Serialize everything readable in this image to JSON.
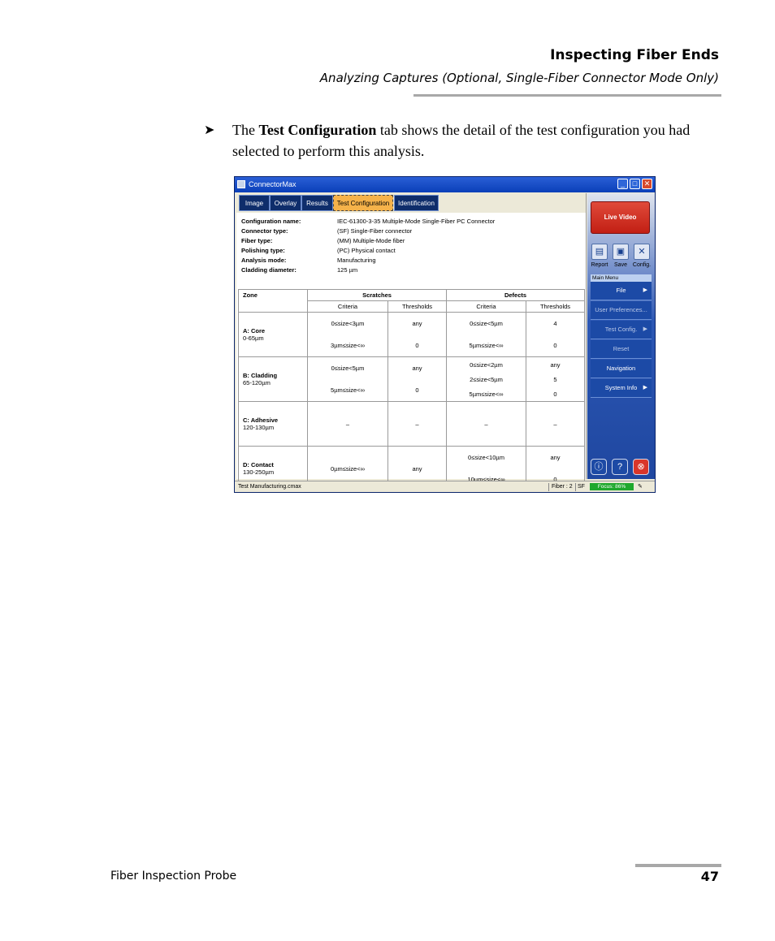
{
  "header": {
    "title": "Inspecting Fiber Ends",
    "subtitle": "Analyzing Captures (Optional, Single-Fiber Connector Mode Only)"
  },
  "body": {
    "bullet": "➤",
    "text_pre": "The ",
    "text_bold": "Test Configuration",
    "text_post": " tab shows the detail of the test configuration you had selected to perform this analysis."
  },
  "app": {
    "title": "ConnectorMax",
    "window_buttons": [
      "_",
      "□",
      "✕"
    ],
    "tabs": [
      "Image",
      "Overlay",
      "Results",
      "Test Configuration",
      "Identification"
    ],
    "info": [
      {
        "label": "Configuration name:",
        "value": "IEC-61300-3-35 Multiple-Mode Single-Fiber PC Connector"
      },
      {
        "label": "Connector type:",
        "value": "(SF) Single-Fiber connector"
      },
      {
        "label": "Fiber type:",
        "value": "(MM) Multiple-Mode fiber"
      },
      {
        "label": "Polishing type:",
        "value": "(PC) Physical contact"
      },
      {
        "label": "Analysis mode:",
        "value": "Manufacturing"
      },
      {
        "label": "Cladding diameter:",
        "value": "125 µm"
      }
    ],
    "table": {
      "h_zone": "Zone",
      "h_scratches": "Scratches",
      "h_defects": "Defects",
      "h_criteria": "Criteria",
      "h_thresholds": "Thresholds",
      "rows": [
        {
          "zone": "A: Core",
          "range": "0-65µm",
          "s_crit": [
            "0≤size<3µm",
            "3µm≤size<∞"
          ],
          "s_thr": [
            "any",
            "0"
          ],
          "d_crit": [
            "0≤size<5µm",
            "5µm≤size<∞"
          ],
          "d_thr": [
            "4",
            "0"
          ]
        },
        {
          "zone": "B: Cladding",
          "range": "65-120µm",
          "s_crit": [
            "0≤size<5µm",
            "5µm≤size<∞"
          ],
          "s_thr": [
            "any",
            "0"
          ],
          "d_crit": [
            "0≤size<2µm",
            "2≤size<5µm",
            "5µm≤size<∞"
          ],
          "d_thr": [
            "any",
            "5",
            "0"
          ]
        },
        {
          "zone": "C: Adhesive",
          "range": "120-130µm",
          "s_crit": [
            "–"
          ],
          "s_thr": [
            "–"
          ],
          "d_crit": [
            "–"
          ],
          "d_thr": [
            "–"
          ]
        },
        {
          "zone": "D: Contact",
          "range": "130-250µm",
          "s_crit": [
            "0µm≤size<∞"
          ],
          "s_thr": [
            "any"
          ],
          "d_crit": [
            "0≤size<10µm",
            "10µm≤size<∞"
          ],
          "d_thr": [
            "any",
            "0"
          ]
        }
      ]
    },
    "side": {
      "live_video": "Live Video",
      "report": "Report",
      "save": "Save",
      "config": "Config.",
      "main_menu": "Main Menu",
      "menu": [
        "File",
        "User Preferences...",
        "Test Config.",
        "Reset",
        "Navigation",
        "System Info"
      ]
    },
    "status": {
      "file": "Test Manufacturing.cmax",
      "fiber": "Fiber : 2",
      "sf": "SF",
      "focus": "Focus: 86%"
    }
  },
  "footer": {
    "left": "Fiber Inspection Probe",
    "page": "47"
  }
}
